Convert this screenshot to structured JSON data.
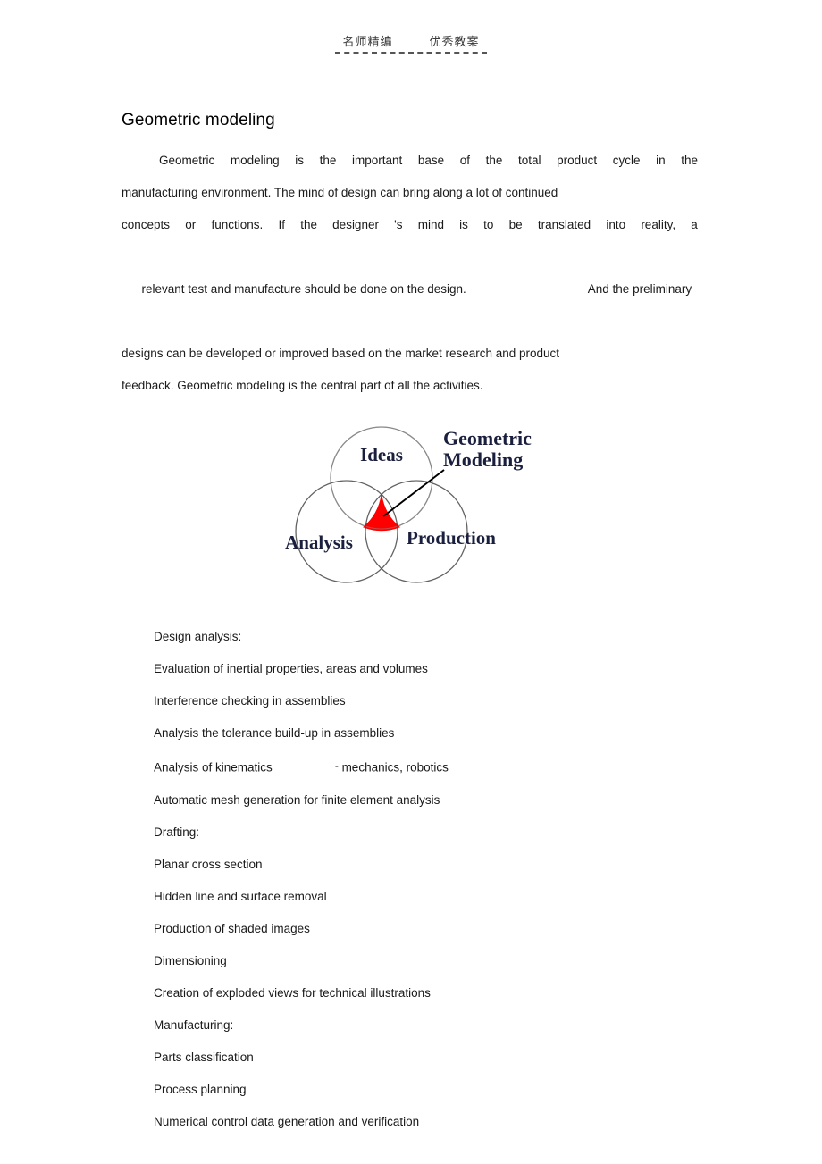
{
  "page_header": {
    "text": "名师精编        优秀教案",
    "rule": "dashed-underline"
  },
  "document": {
    "title": "Geometric modeling",
    "paragraph_lines": [
      {
        "style": "justified",
        "words": [
          "Geometric",
          "modeling",
          "is",
          "the",
          "important",
          "base",
          "of",
          "the",
          "total",
          "product",
          "cycle",
          "in",
          "the"
        ],
        "indent": true
      },
      {
        "style": "plain",
        "text": "manufacturing environment. The mind of design can bring along a lot of continued"
      },
      {
        "style": "justified",
        "words": [
          "concepts",
          "or",
          "functions.",
          "If",
          "the",
          "designer",
          "'s",
          "mind",
          "is",
          "to",
          "be",
          "translated",
          "into",
          "reality,",
          "a"
        ],
        "indent": false
      },
      {
        "style": "gap",
        "lead": "relevant test and manufacture should be done on the design.",
        "tail": "And the preliminary"
      },
      {
        "style": "plain",
        "text": "designs can be developed or improved based on the market research and product"
      },
      {
        "style": "plain",
        "text": "feedback. Geometric modeling is the central part of all the activities."
      }
    ]
  },
  "figure": {
    "name": "venn-diagram",
    "callout_label_line1": "Geometric",
    "callout_label_line2": "Modeling",
    "circle_labels": {
      "top": "Ideas",
      "left": "Analysis",
      "right": "Production"
    },
    "colors": {
      "highlight": "#FF0000",
      "circle_stroke": "#808080",
      "label": "#1a1f3d",
      "leader_line": "#000000"
    }
  },
  "list": {
    "items": [
      {
        "text": "Design analysis:"
      },
      {
        "text": "Evaluation of inertial properties, areas and volumes"
      },
      {
        "text": "Interference checking in assemblies"
      },
      {
        "text": "Analysis the tolerance build-up in assemblies"
      },
      {
        "text": "Analysis of kinematics",
        "gap_suffix_dash": "-",
        "gap_suffix": " mechanics, robotics"
      },
      {
        "text": "Automatic mesh generation for finite element analysis"
      },
      {
        "text": "Drafting:"
      },
      {
        "text": "Planar cross section"
      },
      {
        "text": "Hidden line and surface removal"
      },
      {
        "text": "Production of shaded images"
      },
      {
        "text": "Dimensioning"
      },
      {
        "text": "Creation of exploded views for technical illustrations"
      },
      {
        "text": "Manufacturing:"
      },
      {
        "text": "Parts classification"
      },
      {
        "text": "Process planning"
      },
      {
        "text": "Numerical control data generation and verification"
      }
    ]
  }
}
